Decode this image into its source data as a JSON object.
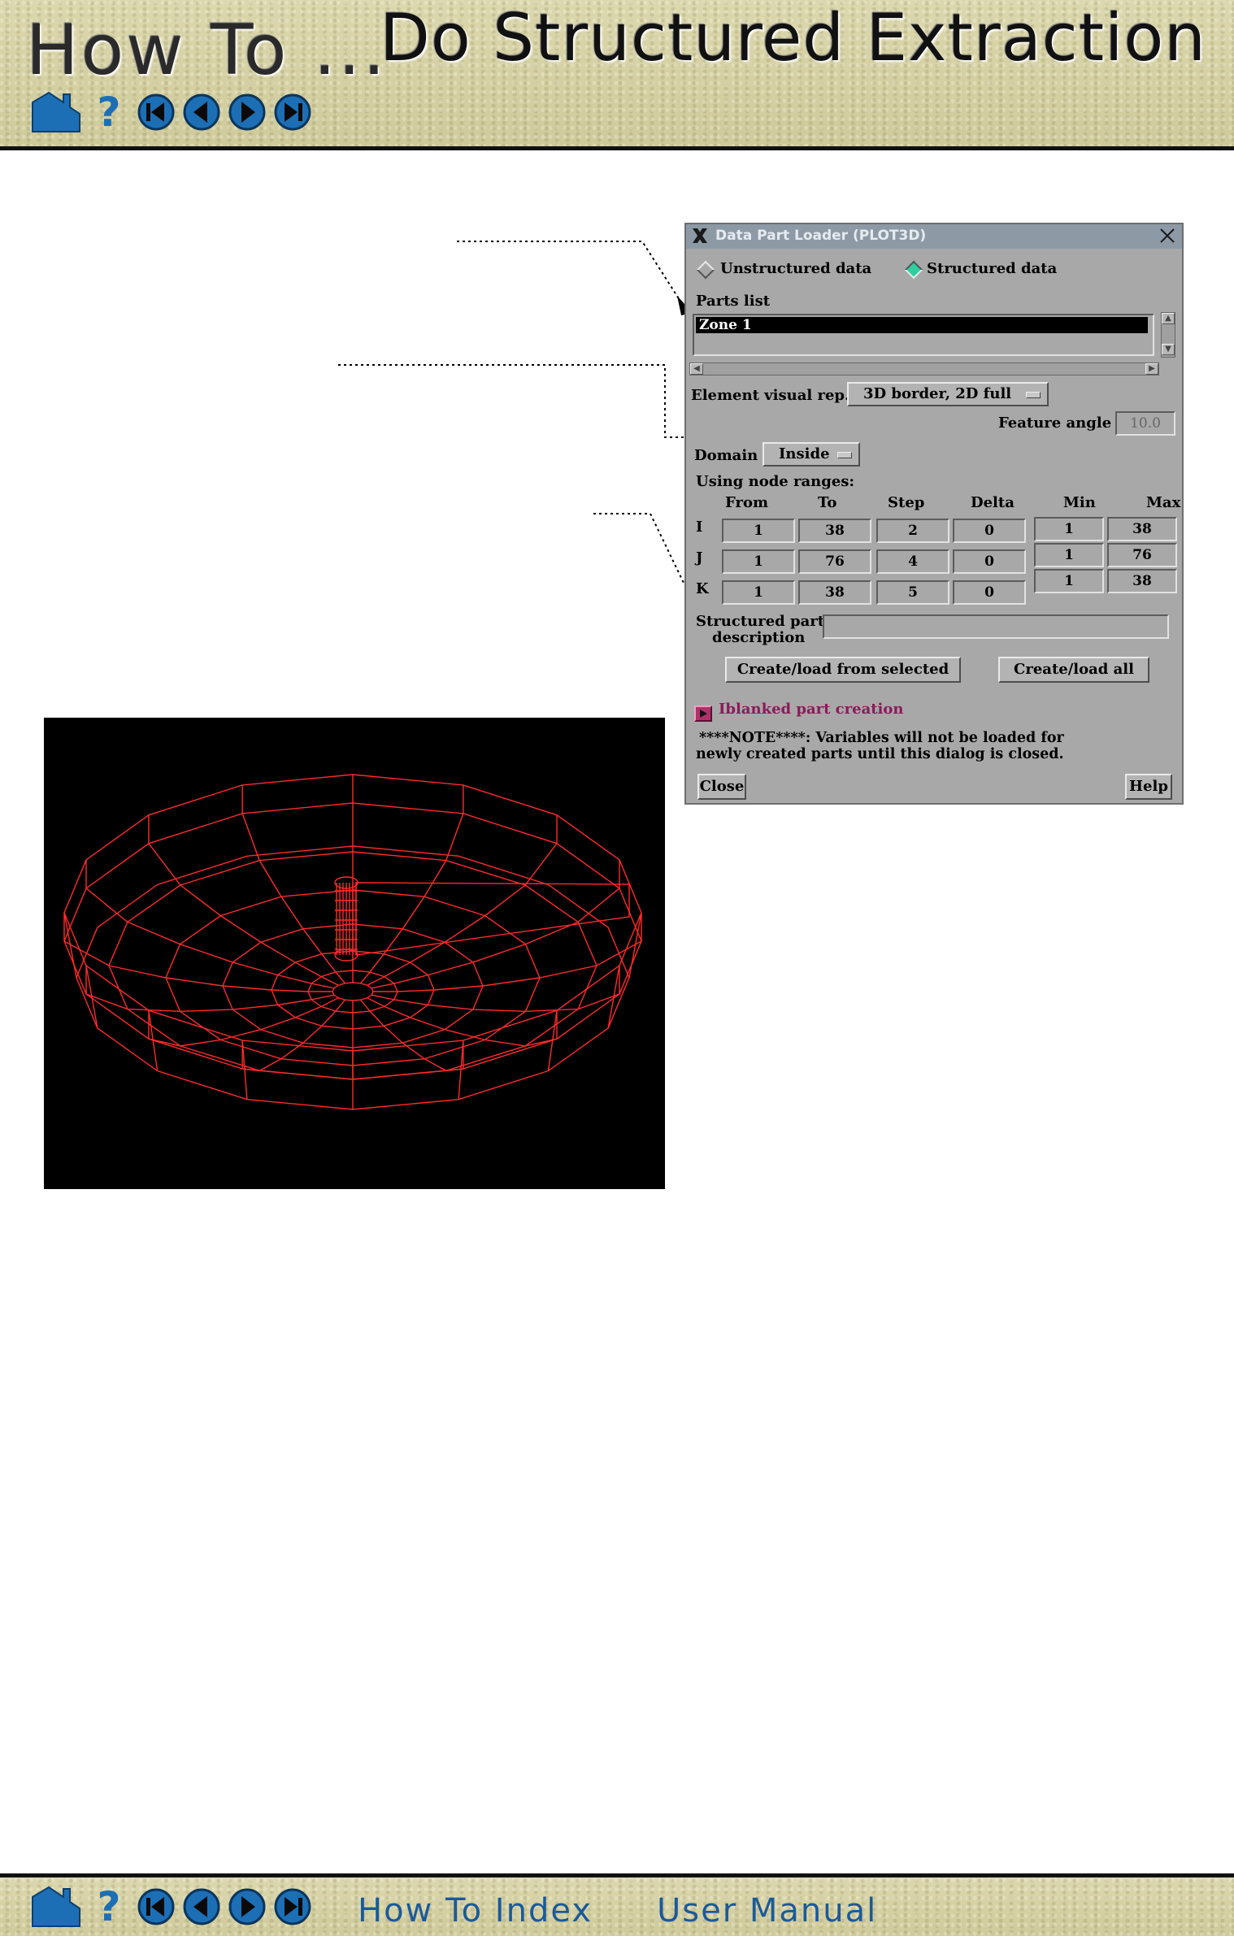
{
  "header": {
    "howto_title": "How To ...",
    "topic_title": "Do Structured Extraction"
  },
  "nav_icons": [
    "home-icon",
    "help-icon",
    "first-page-icon",
    "previous-page-icon",
    "next-page-icon",
    "last-page-icon"
  ],
  "colors": {
    "banner": "#d8d3a8",
    "nav_blue": "#1d6fb5",
    "wireframe": "#ff2a2a",
    "dialog_bg": "#a8a8a8",
    "accent_pink": "#8c1a5a"
  },
  "dialog": {
    "title": "Data Part Loader (PLOT3D)",
    "radio_unstructured": "Unstructured data",
    "radio_structured": "Structured data",
    "selected_radio": "Structured data",
    "parts_list_label": "Parts list",
    "parts": [
      "Zone 1"
    ],
    "element_visual_rep_label": "Element visual rep.",
    "element_visual_rep_value": "3D border, 2D full",
    "feature_angle_label": "Feature angle",
    "feature_angle_value": "10.0",
    "domain_label": "Domain",
    "domain_value": "Inside",
    "node_ranges_label": "Using node ranges:",
    "columns": {
      "from": "From",
      "to": "To",
      "step": "Step",
      "delta": "Delta",
      "min": "Min",
      "max": "Max"
    },
    "rows": [
      {
        "axis": "I",
        "from": "1",
        "to": "38",
        "step": "2",
        "delta": "0",
        "min": "1",
        "max": "38"
      },
      {
        "axis": "J",
        "from": "1",
        "to": "76",
        "step": "4",
        "delta": "0",
        "min": "1",
        "max": "76"
      },
      {
        "axis": "K",
        "from": "1",
        "to": "38",
        "step": "5",
        "delta": "0",
        "min": "1",
        "max": "38"
      }
    ],
    "description_label_1": "Structured part",
    "description_label_2": "description",
    "description_value": "",
    "create_selected_button": "Create/load from selected",
    "create_all_button": "Create/load all",
    "iblanked_label": "Iblanked part creation",
    "note_line_1": "****NOTE****: Variables will not be loaded for",
    "note_line_2": "newly created parts until this dialog is closed.",
    "close_button": "Close",
    "help_button": "Help"
  },
  "footer": {
    "howto_index_link": "How To Index",
    "user_manual_link": "User Manual"
  }
}
